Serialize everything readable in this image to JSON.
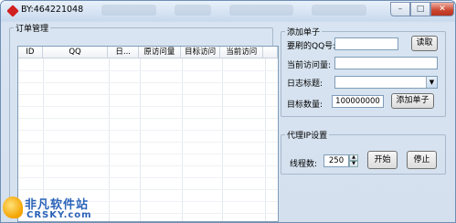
{
  "window": {
    "title": "BY:464221048",
    "controls": {
      "minimize": "–",
      "maximize": "□",
      "close": "✕"
    }
  },
  "orders": {
    "legend": "订单管理",
    "columns": [
      "ID",
      "QQ",
      "日...",
      "原访问量",
      "目标访问",
      "当前访问",
      ""
    ]
  },
  "add_order": {
    "legend": "添加单子",
    "qq_label": "要刷的QQ号:",
    "qq_value": "",
    "read_button": "读取",
    "visits_label": "当前访问量:",
    "visits_value": "",
    "diary_label": "日志标题:",
    "diary_value": "",
    "target_label": "目标数量:",
    "target_value": "100000000",
    "add_button": "添加单子"
  },
  "proxy": {
    "legend": "代理IP设置",
    "threads_label": "线程数:",
    "threads_value": "250",
    "start_button": "开始",
    "stop_button": "停止"
  },
  "watermark": {
    "cn": "非凡软件站",
    "en": "CRSKY.com"
  },
  "icons": {
    "app": "app-diamond-icon",
    "combo": "chevron-down-icon",
    "spin_up": "spin-up-icon",
    "spin_down": "spin-down-icon"
  },
  "colors": {
    "frame": "#d4e0ee",
    "border": "#7f9db9",
    "close": "#c9452e",
    "watermark": "#2a62b8"
  }
}
